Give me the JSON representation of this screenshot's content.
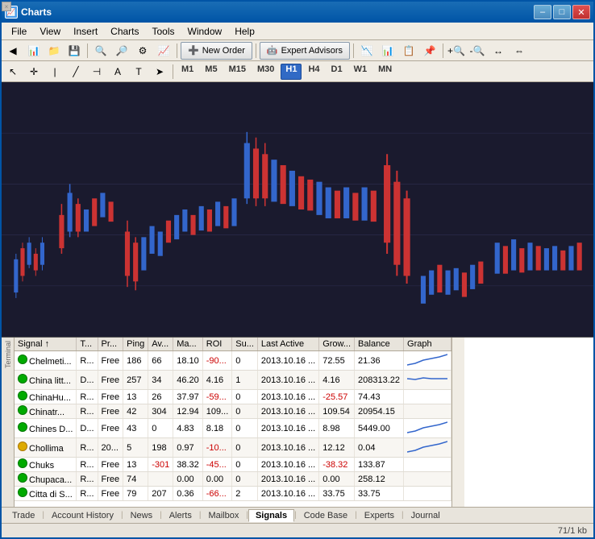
{
  "window": {
    "title": "Charts",
    "min_btn": "–",
    "max_btn": "□",
    "close_btn": "✕"
  },
  "menu": {
    "items": [
      "File",
      "View",
      "Insert",
      "Charts",
      "Tools",
      "Window",
      "Help"
    ]
  },
  "toolbar1": {
    "new_order_label": "New Order",
    "expert_advisors_label": "Expert Advisors"
  },
  "toolbar2": {
    "timeframes": [
      "M1",
      "M5",
      "M15",
      "M30",
      "H1",
      "H4",
      "D1",
      "W1",
      "MN"
    ]
  },
  "table": {
    "headers": [
      "Signal",
      "T...",
      "Pr...",
      "Ping",
      "Av...",
      "Ma...",
      "ROI",
      "Su...",
      "Last Active",
      "Grow...",
      "Balance",
      "Graph"
    ],
    "rows": [
      {
        "indicator": "green",
        "name": "Chelmeti...",
        "t": "R...",
        "price": "Free",
        "ping": 186,
        "avg": 66,
        "max": "18.10",
        "roi": "-90...",
        "sub": 0,
        "lastActive": "2013.10.16 ...",
        "growth": "72.55",
        "balance": "21.36",
        "hasChart": true
      },
      {
        "indicator": "green",
        "name": "China litt...",
        "t": "D...",
        "price": "Free",
        "ping": 257,
        "avg": 34,
        "max": "46.20",
        "roi": "4.16",
        "sub": 1,
        "lastActive": "2013.10.16 ...",
        "growth": "4.16",
        "balance": "208313.22",
        "hasChart": true
      },
      {
        "indicator": "green",
        "name": "ChinaHu...",
        "t": "R...",
        "price": "Free",
        "ping": 13,
        "avg": 26,
        "max": "37.97",
        "roi": "-59...",
        "sub": 0,
        "lastActive": "2013.10.16 ...",
        "growth": "-25.57",
        "balance": "74.43",
        "hasChart": false
      },
      {
        "indicator": "green",
        "name": "Chinatr...",
        "t": "R...",
        "price": "Free",
        "ping": 42,
        "avg": 304,
        "max": "12.94",
        "roi": "109...",
        "sub": 0,
        "lastActive": "2013.10.16 ...",
        "growth": "109.54",
        "balance": "20954.15",
        "hasChart": false
      },
      {
        "indicator": "green",
        "name": "Chines D...",
        "t": "D...",
        "price": "Free",
        "ping": 43,
        "avg": 0,
        "max": "4.83",
        "roi": "8.18",
        "sub": 0,
        "lastActive": "2013.10.16 ...",
        "growth": "8.98",
        "balance": "5449.00",
        "hasChart": true
      },
      {
        "indicator": "yellow",
        "name": "Chollima",
        "t": "R...",
        "price": "20...",
        "ping": 5,
        "avg": 198,
        "max": "0.97",
        "roi": "-10...",
        "sub": 0,
        "lastActive": "2013.10.16 ...",
        "growth": "12.12",
        "balance": "0.04",
        "hasChart": true
      },
      {
        "indicator": "green",
        "name": "Chuks",
        "t": "R...",
        "price": "Free",
        "ping": 13,
        "avg": -301,
        "max": "38.32",
        "roi": "-45...",
        "sub": 0,
        "lastActive": "2013.10.16 ...",
        "growth": "-38.32",
        "balance": "133.87",
        "hasChart": false
      },
      {
        "indicator": "green",
        "name": "Chupaca...",
        "t": "R...",
        "price": "Free",
        "ping": 74,
        "avg": "",
        "max": "0.00",
        "roi": "0.00",
        "sub": 0,
        "lastActive": "2013.10.16 ...",
        "growth": "0.00",
        "balance": "258.12",
        "hasChart": false
      },
      {
        "indicator": "green",
        "name": "Citta di S...",
        "t": "R...",
        "price": "Free",
        "ping": 79,
        "avg": 207,
        "max": "0.36",
        "roi": "-66...",
        "sub": 2,
        "lastActive": "2013.10.16 ...",
        "growth": "33.75",
        "balance": "33.75",
        "hasChart": false
      }
    ]
  },
  "tabs": {
    "items": [
      "Trade",
      "Account History",
      "News",
      "Alerts",
      "Mailbox",
      "Signals",
      "Code Base",
      "Experts",
      "Journal"
    ],
    "active": "Signals"
  },
  "status": {
    "text": "71/1 kb"
  }
}
